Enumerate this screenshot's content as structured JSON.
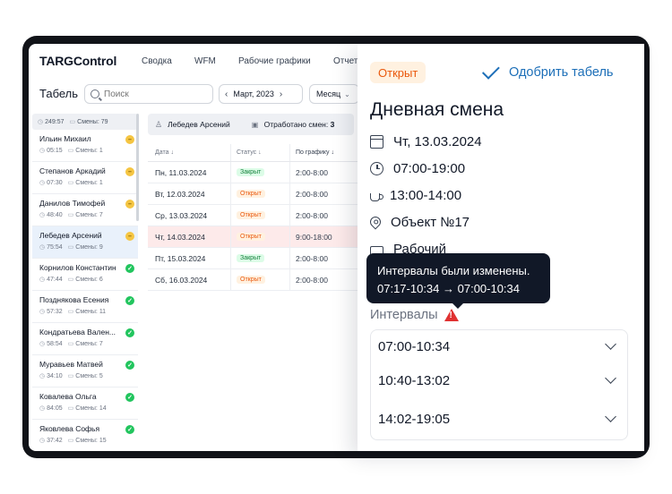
{
  "nav": {
    "brand": "TARGControl",
    "items": [
      "Сводка",
      "WFM",
      "Рабочие графики",
      "Отчет"
    ]
  },
  "toolbar": {
    "title": "Табель",
    "search_placeholder": "Поиск",
    "month": "Март, 2023",
    "period": "Месяц"
  },
  "summary": {
    "hours": "249:57",
    "shifts": "Смены: 79"
  },
  "employees": [
    {
      "name": "Ильин Михаил",
      "hours": "05:15",
      "shifts": "Смены: 1",
      "status": "warn"
    },
    {
      "name": "Степанов Аркадий",
      "hours": "07:30",
      "shifts": "Смены: 1",
      "status": "warn"
    },
    {
      "name": "Данилов Тимофей",
      "hours": "48:40",
      "shifts": "Смены: 7",
      "status": "warn"
    },
    {
      "name": "Лебедев Арсений",
      "hours": "75:54",
      "shifts": "Смены: 9",
      "status": "warn"
    },
    {
      "name": "Корнилов Константин",
      "hours": "47:44",
      "shifts": "Смены: 6",
      "status": "ok"
    },
    {
      "name": "Позднякова Есения",
      "hours": "57:32",
      "shifts": "Смены: 11",
      "status": "ok"
    },
    {
      "name": "Кондратьева Вален...",
      "hours": "58:54",
      "shifts": "Смены: 7",
      "status": "ok"
    },
    {
      "name": "Муравьев Матвей",
      "hours": "34:10",
      "shifts": "Смены: 5",
      "status": "ok"
    },
    {
      "name": "Ковалева Ольга",
      "hours": "84:05",
      "shifts": "Смены: 14",
      "status": "ok"
    },
    {
      "name": "Яковлева Софья",
      "hours": "37:42",
      "shifts": "Смены: 15",
      "status": "ok"
    }
  ],
  "selected_employee": {
    "name": "Лебедев Арсений",
    "worked_label": "Отработано смен:",
    "worked_count": "3"
  },
  "table": {
    "headers": [
      "Дата",
      "Статус",
      "По графику"
    ],
    "rows": [
      {
        "date": "Пн, 11.03.2024",
        "status": "Закрыт",
        "kind": "closed",
        "schedule": "2:00-8:00"
      },
      {
        "date": "Вт, 12.03.2024",
        "status": "Открыт",
        "kind": "open",
        "schedule": "2:00-8:00"
      },
      {
        "date": "Ср, 13.03.2024",
        "status": "Открыт",
        "kind": "open",
        "schedule": "2:00-8:00"
      },
      {
        "date": "Чт, 14.03.2024",
        "status": "Открыт",
        "kind": "open",
        "schedule": "9:00-18:00"
      },
      {
        "date": "Пт, 15.03.2024",
        "status": "Закрыт",
        "kind": "closed",
        "schedule": "2:00-8:00"
      },
      {
        "date": "Сб, 16.03.2024",
        "status": "Открыт",
        "kind": "open",
        "schedule": "2:00-8:00"
      }
    ]
  },
  "drawer": {
    "status": "Открыт",
    "approve_label": "Одобрить табель",
    "title": "Дневная смена",
    "date": "Чт, 13.03.2024",
    "time": "07:00-19:00",
    "break": "13:00-14:00",
    "location": "Объект №17",
    "type": "Рабочий",
    "intervals_label": "Интервалы",
    "intervals": [
      "07:00-10:34",
      "10:40-13:02",
      "14:02-19:05"
    ]
  },
  "tooltip": {
    "line1": "Интервалы были изменены.",
    "line2": "07:17-10:34 → 07:00-10:34"
  },
  "colors": {
    "accent": "#1d6fb8",
    "open": "#ea580c",
    "closed": "#15803d",
    "warn": "#e03131",
    "frame": "#111318"
  }
}
